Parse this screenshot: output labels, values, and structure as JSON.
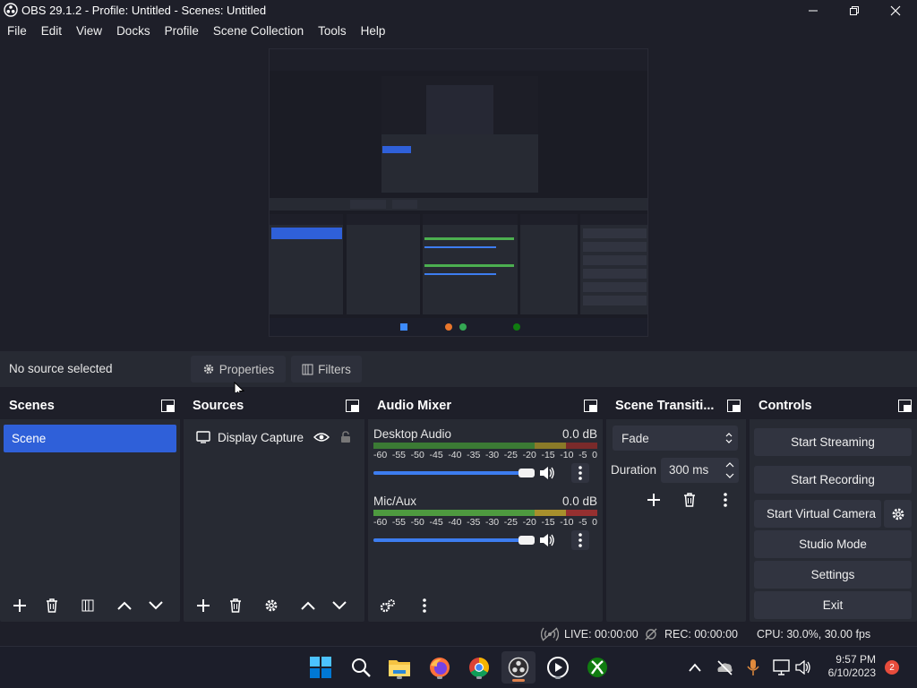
{
  "window": {
    "title": "OBS 29.1.2 - Profile: Untitled - Scenes: Untitled"
  },
  "menu": [
    "File",
    "Edit",
    "View",
    "Docks",
    "Profile",
    "Scene Collection",
    "Tools",
    "Help"
  ],
  "source_toolbar": {
    "no_source": "No source selected",
    "properties": "Properties",
    "filters": "Filters"
  },
  "scenes": {
    "title": "Scenes",
    "items": [
      "Scene"
    ]
  },
  "sources": {
    "title": "Sources",
    "items": [
      {
        "name": "Display Capture",
        "icon": "monitor-icon"
      }
    ]
  },
  "audio_mixer": {
    "title": "Audio Mixer",
    "ticks": [
      "-60",
      "-55",
      "-50",
      "-45",
      "-40",
      "-35",
      "-30",
      "-25",
      "-20",
      "-15",
      "-10",
      "-5",
      "0"
    ],
    "channels": [
      {
        "name": "Desktop Audio",
        "db": "0.0 dB",
        "volume": 1.0
      },
      {
        "name": "Mic/Aux",
        "db": "0.0 dB",
        "volume": 1.0
      }
    ]
  },
  "transitions": {
    "title": "Scene Transiti...",
    "selected": "Fade",
    "duration_label": "Duration",
    "duration_value": "300 ms"
  },
  "controls": {
    "title": "Controls",
    "start_streaming": "Start Streaming",
    "start_recording": "Start Recording",
    "start_virtual_camera": "Start Virtual Camera",
    "studio_mode": "Studio Mode",
    "settings": "Settings",
    "exit": "Exit"
  },
  "status": {
    "live": "LIVE: 00:00:00",
    "rec": "REC: 00:00:00",
    "cpu": "CPU: 30.0%, 30.00 fps"
  },
  "taskbar": {
    "apps": [
      "windows-start-icon",
      "search-icon",
      "file-explorer-icon",
      "firefox-icon",
      "chrome-icon",
      "obs-icon",
      "media-player-icon",
      "xbox-icon"
    ],
    "time": "9:57 PM",
    "date": "6/10/2023",
    "notifications": "2"
  },
  "colors": {
    "accent": "#2f60d9",
    "slider": "#3d7df0",
    "meter_green": "#4caf50",
    "meter_yellow": "#c9a227",
    "meter_red": "#c0392b"
  }
}
